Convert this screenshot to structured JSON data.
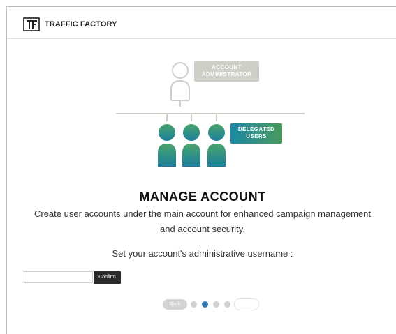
{
  "header": {
    "logo_text": "TF",
    "brand": "TRAFFIC FACTORY"
  },
  "diagram": {
    "admin_label_line1": "ACCOUNT",
    "admin_label_line2": "ADMINISTRATOR",
    "delegated_label_line1": "DELEGATED",
    "delegated_label_line2": "USERS"
  },
  "main": {
    "title": "MANAGE ACCOUNT",
    "description_line1": "Create user accounts under the main account for enhanced campaign management",
    "description_line2": "and account security.",
    "prompt": "Set your account's administrative username :"
  },
  "form": {
    "username_value": "",
    "confirm_label": "Confirm"
  },
  "pager": {
    "back_label": "Back",
    "current_step": 2,
    "total_steps": 4
  },
  "colors": {
    "admin_gray": "#cfcfc8",
    "delegated_teal": "#1b88a6",
    "delegated_green": "#4a9a5c",
    "active_dot": "#2b78b3"
  }
}
